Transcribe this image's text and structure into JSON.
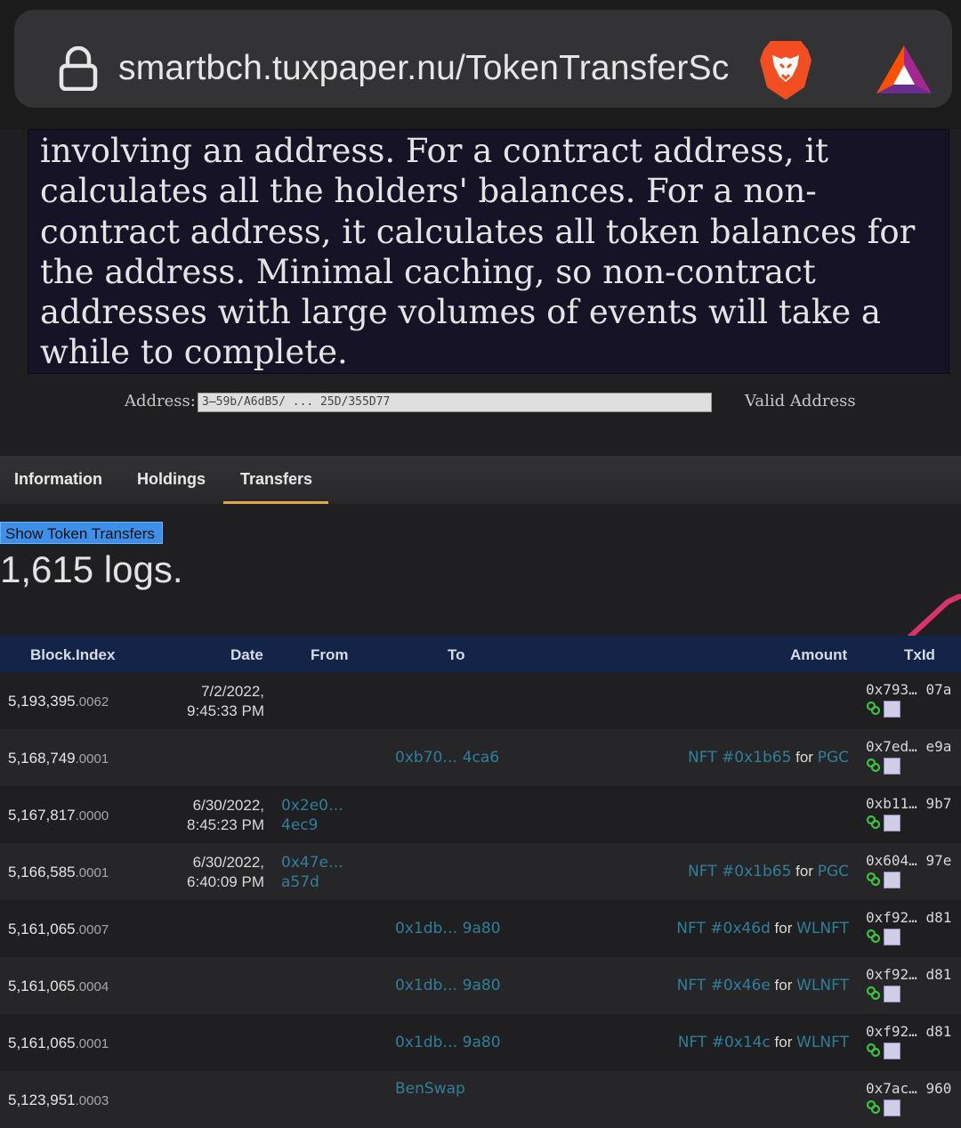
{
  "browser": {
    "url": "smartbch.tuxpaper.nu/TokenTransferSc",
    "lock_icon": "lock-icon",
    "brave_icon": "brave-lion-icon",
    "rewards_icon": "bat-triangle-icon"
  },
  "description": "involving an address. For a contract address, it calculates all the holders' balances. For a non-contract address, it calculates all token balances for the address. Minimal caching, so non-contract addresses with large volumes of events will take a while to complete.",
  "address": {
    "label": "Address:",
    "value": "3̶59b/A6dB5/ ... 25D/355D77",
    "status": "Valid Address"
  },
  "tabs": [
    {
      "label": "Information",
      "active": false
    },
    {
      "label": "Holdings",
      "active": false
    },
    {
      "label": "Transfers",
      "active": true
    }
  ],
  "show_button": "Show Token Transfers",
  "log_count": "1,615 logs.",
  "table": {
    "headers": {
      "block": "Block.Index",
      "date": "Date",
      "from": "From",
      "to": "To",
      "amount": "Amount",
      "txid": "TxId"
    },
    "rows": [
      {
        "block": "5,193,395",
        "index": ".0062",
        "date1": "7/2/2022,",
        "date2": "9:45:33 PM",
        "from1": "",
        "from2": "",
        "to": "",
        "nft": "",
        "for": "",
        "token": "",
        "tx1": "0x793…",
        "tx2": "07a"
      },
      {
        "block": "5,168,749",
        "index": ".0001",
        "date1": "",
        "date2": "",
        "from1": "",
        "from2": "",
        "to": "0xb70… 4ca6",
        "nft": "NFT #0x1b65",
        "for": "for",
        "token": "PGC",
        "tx1": "0x7ed…",
        "tx2": "e9a"
      },
      {
        "block": "5,167,817",
        "index": ".0000",
        "date1": "6/30/2022,",
        "date2": "8:45:23 PM",
        "from1": "0x2e0…",
        "from2": "4ec9",
        "to": "",
        "nft": "",
        "for": "",
        "token": "",
        "tx1": "0xb11…",
        "tx2": "9b7"
      },
      {
        "block": "5,166,585",
        "index": ".0001",
        "date1": "6/30/2022,",
        "date2": "6:40:09 PM",
        "from1": "0x47e…",
        "from2": "a57d",
        "to": "",
        "nft": "NFT #0x1b65",
        "for": "for",
        "token": "PGC",
        "tx1": "0x604…",
        "tx2": "97e"
      },
      {
        "block": "5,161,065",
        "index": ".0007",
        "date1": "",
        "date2": "",
        "from1": "",
        "from2": "",
        "to": "0x1db… 9a80",
        "nft": "NFT #0x46d",
        "for": "for",
        "token": "WLNFT",
        "tx1": "0xf92…",
        "tx2": "d81"
      },
      {
        "block": "5,161,065",
        "index": ".0004",
        "date1": "",
        "date2": "",
        "from1": "",
        "from2": "",
        "to": "0x1db… 9a80",
        "nft": "NFT #0x46e",
        "for": "for",
        "token": "WLNFT",
        "tx1": "0xf92…",
        "tx2": "d81"
      },
      {
        "block": "5,161,065",
        "index": ".0001",
        "date1": "",
        "date2": "",
        "from1": "",
        "from2": "",
        "to": "0x1db… 9a80",
        "nft": "NFT #0x14c",
        "for": "for",
        "token": "WLNFT",
        "tx1": "0xf92…",
        "tx2": "d81"
      },
      {
        "block": "5,123,951",
        "index": ".0003",
        "date1": "",
        "date2": "",
        "from1": "",
        "from2": "",
        "to": "BenSwap",
        "nft": "",
        "for": "",
        "token": "",
        "tx1": "0x7ac…",
        "tx2": "960"
      }
    ]
  },
  "colors": {
    "link": "#2f7f9c",
    "tab_underline": "#e0a64a",
    "header_bg": "#142448",
    "button_bg": "#3d8fe8",
    "annotation": "#d8336a"
  }
}
